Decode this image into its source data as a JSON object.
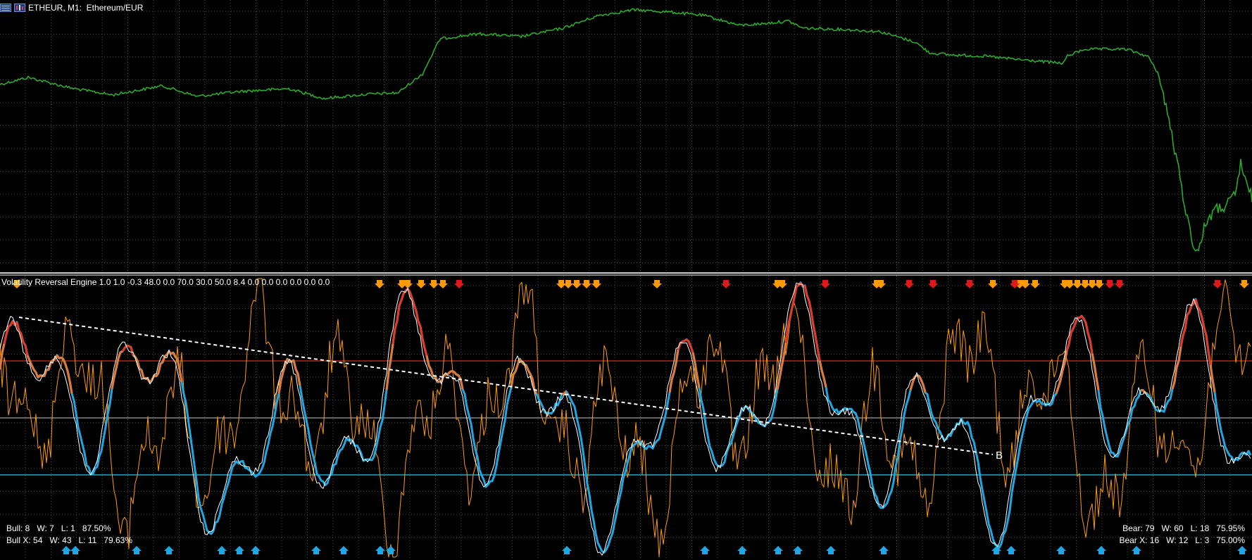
{
  "window": {
    "symbol_title": "ETHEUR, M1:  Ethereum/EUR",
    "icons": [
      "chart-window-icon",
      "chart-type-icon"
    ]
  },
  "colors": {
    "background": "#000000",
    "grid": "#5f5f5f",
    "price_line": "#2ea82e",
    "separator": "#d0d0d0",
    "overbought_line": "#b22222",
    "upper_mid_line": "#c8c8c8",
    "oversold_line": "#20a8c8",
    "bull_signal": "#ff9b00",
    "bear_signal": "#e01818",
    "buy_arrow": "#1fa7e3",
    "trend_line": "#ffffff"
  },
  "indicator": {
    "label": "Volatility Reversal Engine 1.0 1.0 -0.3 48.0 0.0 70.0 30.0 50.0 8.4 0.0 0.0 0.0 0.0 0.0 0.0",
    "marker": "B"
  },
  "stats": {
    "bull_line": "Bull: 8   W: 7   L: 1   87.50%",
    "bull_x_line": "Bull X: 54   W: 43   L: 11   79.63%",
    "bear_line": "Bear: 79   W: 60   L: 18   75.95%",
    "bear_x_line": "Bear X: 16   W: 12   L: 3   75.00%"
  }
}
